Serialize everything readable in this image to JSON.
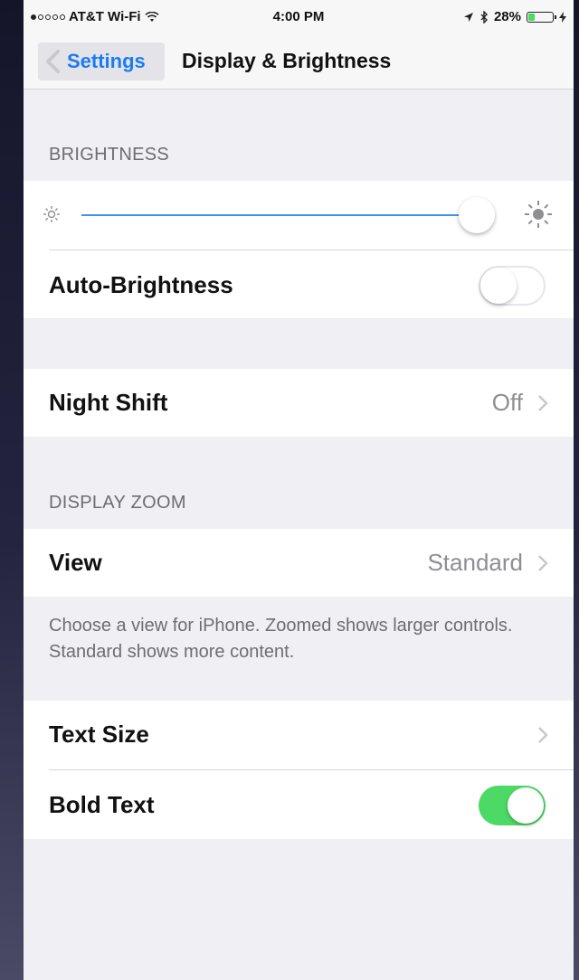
{
  "status_bar": {
    "carrier": "AT&T Wi-Fi",
    "time": "4:00 PM",
    "battery": "28%",
    "battery_level": 0.28,
    "signal_bars": 1,
    "icons": [
      "wifi-icon",
      "location-arrow-icon",
      "bluetooth-icon",
      "battery-icon",
      "charging-icon"
    ]
  },
  "nav": {
    "back_label": "Settings",
    "title": "Display & Brightness"
  },
  "brightness": {
    "header": "BRIGHTNESS",
    "level": 0.97,
    "min_icon": "sun-small-icon",
    "max_icon": "sun-large-icon",
    "auto_label": "Auto-Brightness",
    "auto_on": false
  },
  "night_shift": {
    "label": "Night Shift",
    "value": "Off"
  },
  "display_zoom": {
    "header": "DISPLAY ZOOM",
    "view_label": "View",
    "view_value": "Standard",
    "footer": "Choose a view for iPhone. Zoomed shows larger controls. Standard shows more content."
  },
  "text": {
    "size_label": "Text Size",
    "bold_label": "Bold Text",
    "bold_on": true
  },
  "colors": {
    "accent": "#1a7cf5",
    "toggle_on": "#4cd964",
    "background": "#efeff4"
  }
}
